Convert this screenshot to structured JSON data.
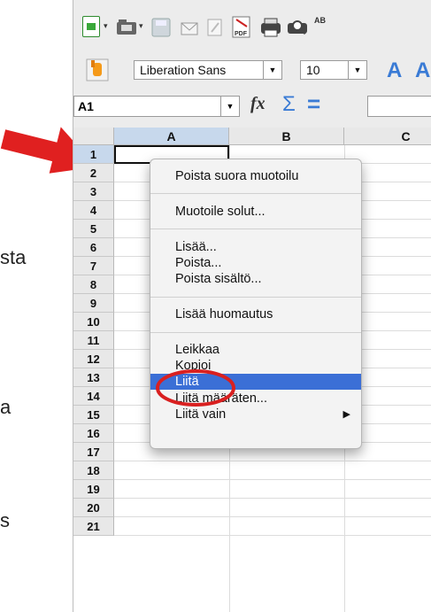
{
  "side_fragments": [
    "sta",
    "a",
    "s"
  ],
  "toolbar": {
    "font_name": "Liberation Sans",
    "font_size": "10",
    "pdf_label": "PDF",
    "spell_label": "AB"
  },
  "formula_bar": {
    "cell_ref": "A1",
    "fx_label": "fx",
    "sum_label": "Σ",
    "equals_label": "="
  },
  "grid": {
    "columns": [
      "A",
      "B",
      "C"
    ],
    "rows": [
      "1",
      "2",
      "3",
      "4",
      "5",
      "6",
      "7",
      "8",
      "9",
      "10",
      "11",
      "12",
      "13",
      "14",
      "15",
      "16",
      "17",
      "18",
      "19",
      "20",
      "21"
    ]
  },
  "context_menu": {
    "items": [
      "Poista suora muotoilu",
      "Muotoile solut...",
      "Lisää...",
      "Poista...",
      "Poista sisältö...",
      "Lisää huomautus",
      "Leikkaa",
      "Kopioi",
      "Liitä",
      "Liitä määräten...",
      "Liitä vain"
    ],
    "highlighted": "Liitä"
  },
  "colors": {
    "arrow": "#e02020",
    "circle": "#d92020",
    "highlight": "#3b6fd6",
    "selection_header": "#c7d8ec"
  }
}
